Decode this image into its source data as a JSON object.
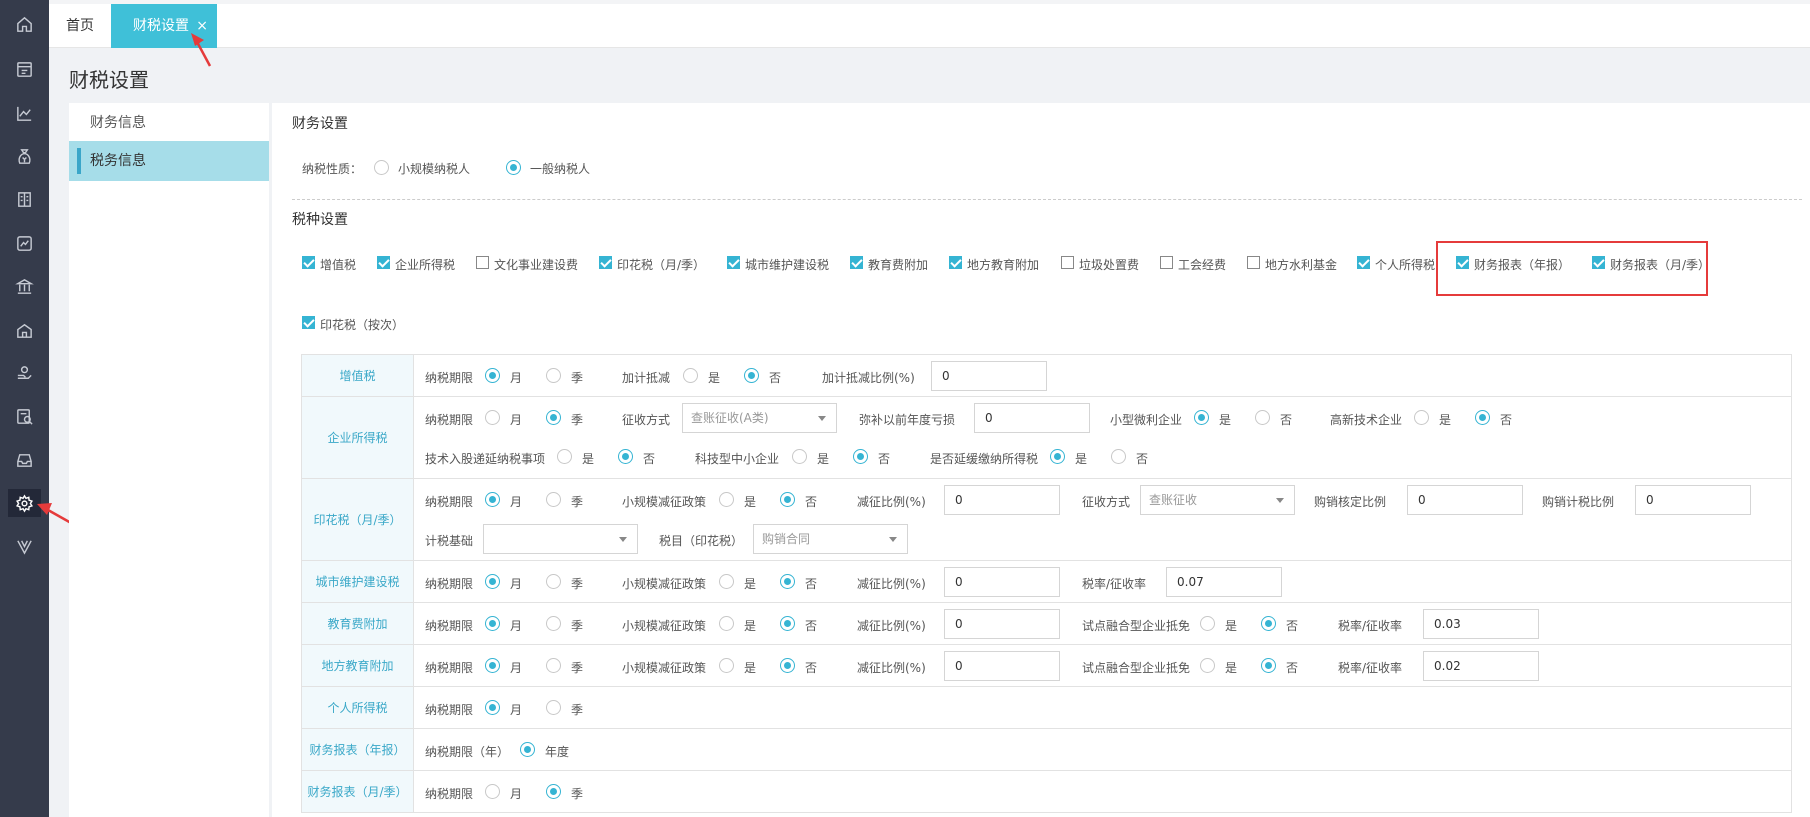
{
  "tabs": {
    "home": "首页",
    "active": "财税设置",
    "close": "×"
  },
  "page_title": "财税设置",
  "sub_menu": {
    "items": [
      "财务信息",
      "税务信息"
    ],
    "active_index": 1
  },
  "main": {
    "finance_section": "财务设置",
    "taxpayer_label": "纳税性质：",
    "taxpayer_options": [
      "小规模纳税人",
      "一般纳税人"
    ],
    "taxpayer_selected": 1,
    "tax_types_section": "税种设置",
    "tax_types": [
      {
        "label": "增值税",
        "checked": true
      },
      {
        "label": "企业所得税",
        "checked": true
      },
      {
        "label": "文化事业建设费",
        "checked": false
      },
      {
        "label": "印花税（月/季）",
        "checked": true
      },
      {
        "label": "城市维护建设税",
        "checked": true
      },
      {
        "label": "教育费附加",
        "checked": true
      },
      {
        "label": "地方教育附加",
        "checked": true
      },
      {
        "label": "垃圾处置费",
        "checked": false
      },
      {
        "label": "工会经费",
        "checked": false
      },
      {
        "label": "地方水利基金",
        "checked": false
      },
      {
        "label": "个人所得税",
        "checked": true
      },
      {
        "label": "财务报表（年报）",
        "checked": true
      },
      {
        "label": "财务报表（月/季）",
        "checked": true
      },
      {
        "label": "印花税（按次）",
        "checked": true
      }
    ]
  },
  "table": {
    "common": {
      "period": "纳税期限",
      "month": "月",
      "quarter": "季",
      "yes": "是",
      "no": "否",
      "small_policy": "小规模减征政策",
      "reduce_ratio": "减征比例(%)",
      "rate": "税率/征收率",
      "pilot": "试点融合型企业抵免",
      "year_period": "纳税期限（年）",
      "year": "年度"
    },
    "vat": {
      "name": "增值税",
      "deduct": "加计抵减",
      "deduct_ratio": "加计抵减比例(%)",
      "deduct_ratio_value": "0"
    },
    "cit": {
      "name": "企业所得税",
      "method": "征收方式",
      "method_value": "查账征收(A类)",
      "loss": "弥补以前年度亏损",
      "loss_value": "0",
      "small_micro": "小型微利企业",
      "high_tech": "高新技术企业",
      "tech_share": "技术入股递延纳税事项",
      "tech_sme": "科技型中小企业",
      "defer": "是否延缓缴纳所得税"
    },
    "stamp": {
      "name": "印花税（月/季）",
      "reduce_value": "0",
      "method": "征收方式",
      "method_value": "查账征收",
      "purchase_ratio": "购销核定比例",
      "purchase_ratio_value": "0",
      "tax_ratio": "购销计税比例",
      "tax_ratio_value": "0",
      "basis": "计税基础",
      "basis_value": "",
      "item": "税目（印花税）",
      "item_value": "购销合同"
    },
    "city": {
      "name": "城市维护建设税",
      "reduce_value": "0",
      "rate_value": "0.07"
    },
    "edu": {
      "name": "教育费附加",
      "reduce_value": "0",
      "rate_value": "0.03"
    },
    "local_edu": {
      "name": "地方教育附加",
      "reduce_value": "0",
      "rate_value": "0.02"
    },
    "pit": {
      "name": "个人所得税"
    },
    "fs_year": {
      "name": "财务报表（年报）"
    },
    "fs_month": {
      "name": "财务报表（月/季）"
    }
  },
  "colors": {
    "accent": "#3fc0d8",
    "sidebar": "#353b4b",
    "highlight": "#e53b3b"
  }
}
